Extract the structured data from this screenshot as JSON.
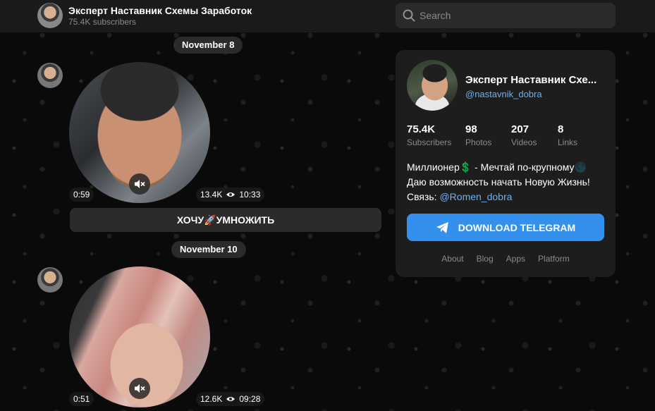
{
  "channel": {
    "title": "Эксперт Наставник Схемы Заработок",
    "subscribers_label": "75.4K subscribers"
  },
  "search": {
    "placeholder": "Search"
  },
  "feed": {
    "dates": [
      "November 8",
      "November 10"
    ],
    "posts": [
      {
        "duration": "0:59",
        "views": "13.4K",
        "time": "10:33",
        "button_label": "ХОЧУ🚀УМНОЖИТЬ"
      },
      {
        "duration": "0:51",
        "views": "12.6K",
        "time": "09:28"
      }
    ]
  },
  "card": {
    "name": "Эксперт Наставник Схе...",
    "handle": "@nastavnik_dobra",
    "stats": [
      {
        "value": "75.4K",
        "label": "Subscribers"
      },
      {
        "value": "98",
        "label": "Photos"
      },
      {
        "value": "207",
        "label": "Videos"
      },
      {
        "value": "8",
        "label": "Links"
      }
    ],
    "description": {
      "line1": "Миллионер💲 - Мечтай по-крупному🌑",
      "line2": "Даю возможность начать Новую Жизнь!",
      "line3_prefix": "Связь: ",
      "line3_link": "@Romen_dobra"
    },
    "download_label": "DOWNLOAD TELEGRAM",
    "links": [
      "About",
      "Blog",
      "Apps",
      "Platform"
    ]
  },
  "colors": {
    "accent": "#3390ec",
    "link": "#6ab2f2"
  }
}
